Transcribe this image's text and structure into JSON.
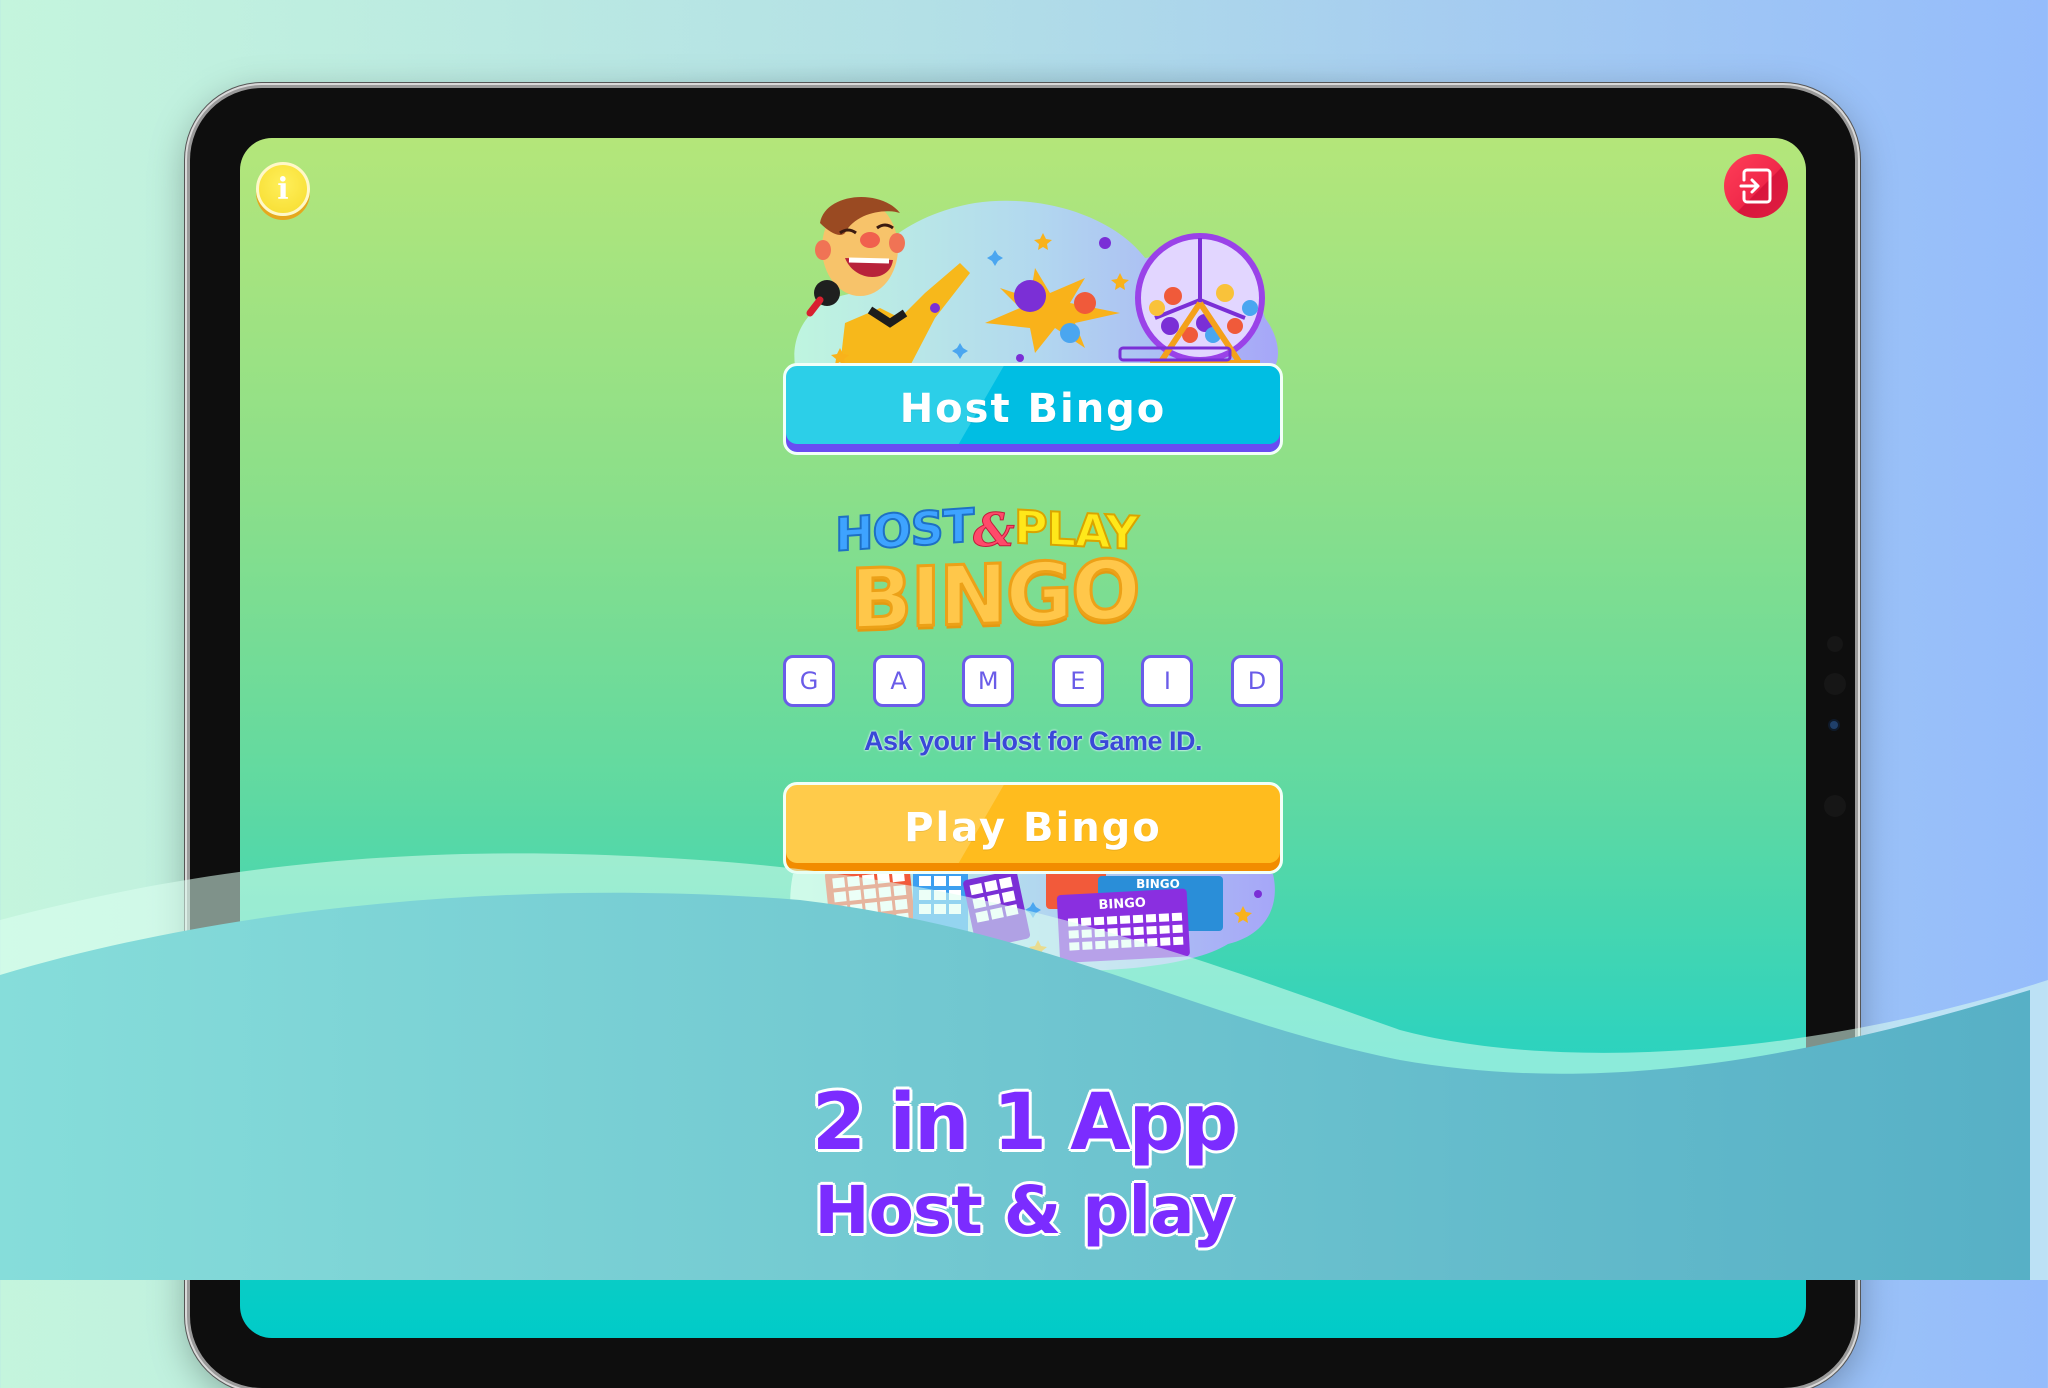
{
  "app": {
    "title": "Host & Play Bingo"
  },
  "colors": {
    "host_button": "#00bee3",
    "play_button": "#ffbc1e",
    "exit_button": "#f0284a",
    "info_button": "#f6dc2e",
    "accent_purple": "#7b2cff",
    "game_id_border": "#6a5ce8",
    "help_text": "#3a48d8"
  },
  "top_bar": {
    "info_icon": "info-icon",
    "info_glyph": "i",
    "exit_icon": "exit-door-icon"
  },
  "illustrations": {
    "top": "bingo-host-with-microphone-and-ball-cage",
    "bottom": "bingo-cards"
  },
  "host_button": {
    "label": "Host Bingo"
  },
  "logo": {
    "word1": "HOST",
    "ampersand": "&",
    "word2": "PLAY",
    "word3": "BINGO"
  },
  "game_id": {
    "characters": [
      "G",
      "A",
      "M",
      "E",
      "I",
      "D"
    ],
    "help_text": "Ask your Host for Game ID."
  },
  "play_button": {
    "label": "Play Bingo"
  },
  "bottom_cards": {
    "card_label": "BINGO"
  },
  "tagline": {
    "line1": "2 in 1 App",
    "line2": "Host & play"
  }
}
